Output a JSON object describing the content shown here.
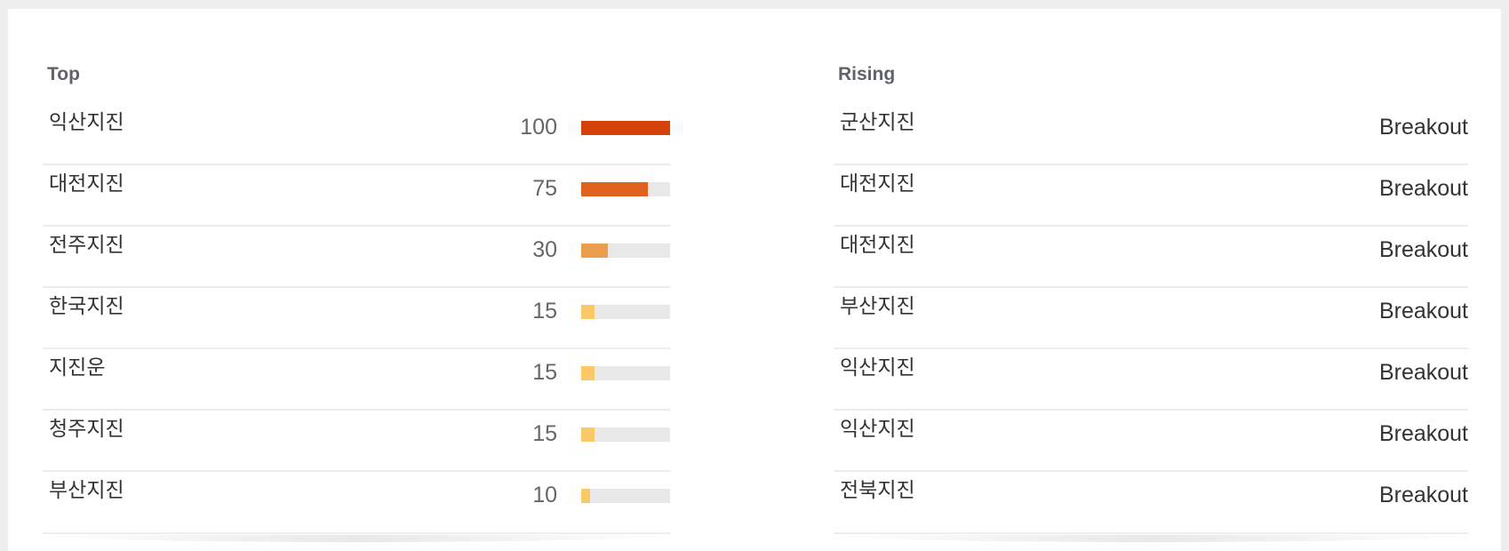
{
  "top": {
    "title": "Top",
    "items": [
      {
        "label": "익산지진",
        "value": "100",
        "level": 100,
        "color": "#d4410a"
      },
      {
        "label": "대전지진",
        "value": "75",
        "level": 75,
        "color": "#e0621f"
      },
      {
        "label": "전주지진",
        "value": "30",
        "level": 30,
        "color": "#eb9e4b"
      },
      {
        "label": "한국지진",
        "value": "15",
        "level": 15,
        "color": "#fbc867"
      },
      {
        "label": "지진운",
        "value": "15",
        "level": 15,
        "color": "#fbc867"
      },
      {
        "label": "청주지진",
        "value": "15",
        "level": 15,
        "color": "#fbc867"
      },
      {
        "label": "부산지진",
        "value": "10",
        "level": 10,
        "color": "#fbc867"
      }
    ]
  },
  "rising": {
    "title": "Rising",
    "items": [
      {
        "label": "군산지진",
        "status": "Breakout"
      },
      {
        "label": "대전지진",
        "status": "Breakout"
      },
      {
        "label": "대전지진",
        "status": "Breakout"
      },
      {
        "label": "부산지진",
        "status": "Breakout"
      },
      {
        "label": "익산지진",
        "status": "Breakout"
      },
      {
        "label": "익산지진",
        "status": "Breakout"
      },
      {
        "label": "전북지진",
        "status": "Breakout"
      }
    ]
  }
}
